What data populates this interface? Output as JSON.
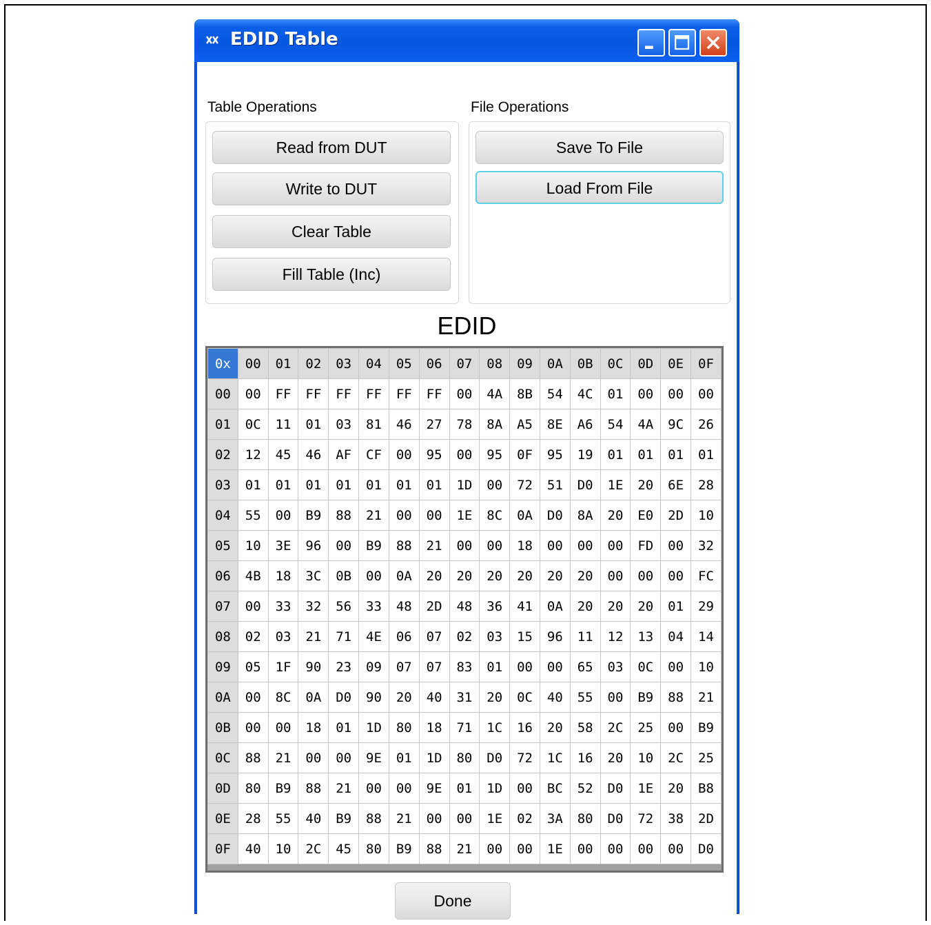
{
  "window": {
    "title": "EDID Table",
    "icon": "maxim-logo-icon",
    "controls": [
      "minimize-icon",
      "maximize-icon",
      "close-icon"
    ]
  },
  "table_operations": {
    "label": "Table Operations",
    "buttons": [
      "Read from DUT",
      "Write to DUT",
      "Clear Table",
      "Fill Table (Inc)"
    ]
  },
  "file_operations": {
    "label": "File Operations",
    "buttons": [
      "Save To File",
      "Load From File"
    ]
  },
  "edid": {
    "title": "EDID",
    "corner": "0x",
    "col_headers": [
      "00",
      "01",
      "02",
      "03",
      "04",
      "05",
      "06",
      "07",
      "08",
      "09",
      "0A",
      "0B",
      "0C",
      "0D",
      "0E",
      "0F"
    ],
    "row_headers": [
      "00",
      "01",
      "02",
      "03",
      "04",
      "05",
      "06",
      "07",
      "08",
      "09",
      "0A",
      "0B",
      "0C",
      "0D",
      "0E",
      "0F"
    ],
    "rows": [
      [
        "00",
        "FF",
        "FF",
        "FF",
        "FF",
        "FF",
        "FF",
        "00",
        "4A",
        "8B",
        "54",
        "4C",
        "01",
        "00",
        "00",
        "00"
      ],
      [
        "0C",
        "11",
        "01",
        "03",
        "81",
        "46",
        "27",
        "78",
        "8A",
        "A5",
        "8E",
        "A6",
        "54",
        "4A",
        "9C",
        "26"
      ],
      [
        "12",
        "45",
        "46",
        "AF",
        "CF",
        "00",
        "95",
        "00",
        "95",
        "0F",
        "95",
        "19",
        "01",
        "01",
        "01",
        "01"
      ],
      [
        "01",
        "01",
        "01",
        "01",
        "01",
        "01",
        "01",
        "1D",
        "00",
        "72",
        "51",
        "D0",
        "1E",
        "20",
        "6E",
        "28"
      ],
      [
        "55",
        "00",
        "B9",
        "88",
        "21",
        "00",
        "00",
        "1E",
        "8C",
        "0A",
        "D0",
        "8A",
        "20",
        "E0",
        "2D",
        "10"
      ],
      [
        "10",
        "3E",
        "96",
        "00",
        "B9",
        "88",
        "21",
        "00",
        "00",
        "18",
        "00",
        "00",
        "00",
        "FD",
        "00",
        "32"
      ],
      [
        "4B",
        "18",
        "3C",
        "0B",
        "00",
        "0A",
        "20",
        "20",
        "20",
        "20",
        "20",
        "20",
        "00",
        "00",
        "00",
        "FC"
      ],
      [
        "00",
        "33",
        "32",
        "56",
        "33",
        "48",
        "2D",
        "48",
        "36",
        "41",
        "0A",
        "20",
        "20",
        "20",
        "01",
        "29"
      ],
      [
        "02",
        "03",
        "21",
        "71",
        "4E",
        "06",
        "07",
        "02",
        "03",
        "15",
        "96",
        "11",
        "12",
        "13",
        "04",
        "14"
      ],
      [
        "05",
        "1F",
        "90",
        "23",
        "09",
        "07",
        "07",
        "83",
        "01",
        "00",
        "00",
        "65",
        "03",
        "0C",
        "00",
        "10"
      ],
      [
        "00",
        "8C",
        "0A",
        "D0",
        "90",
        "20",
        "40",
        "31",
        "20",
        "0C",
        "40",
        "55",
        "00",
        "B9",
        "88",
        "21"
      ],
      [
        "00",
        "00",
        "18",
        "01",
        "1D",
        "80",
        "18",
        "71",
        "1C",
        "16",
        "20",
        "58",
        "2C",
        "25",
        "00",
        "B9"
      ],
      [
        "88",
        "21",
        "00",
        "00",
        "9E",
        "01",
        "1D",
        "80",
        "D0",
        "72",
        "1C",
        "16",
        "20",
        "10",
        "2C",
        "25"
      ],
      [
        "80",
        "B9",
        "88",
        "21",
        "00",
        "00",
        "9E",
        "01",
        "1D",
        "00",
        "BC",
        "52",
        "D0",
        "1E",
        "20",
        "B8"
      ],
      [
        "28",
        "55",
        "40",
        "B9",
        "88",
        "21",
        "00",
        "00",
        "1E",
        "02",
        "3A",
        "80",
        "D0",
        "72",
        "38",
        "2D"
      ],
      [
        "40",
        "10",
        "2C",
        "45",
        "80",
        "B9",
        "88",
        "21",
        "00",
        "00",
        "1E",
        "00",
        "00",
        "00",
        "00",
        "D0"
      ]
    ]
  },
  "footer": {
    "done_label": "Done"
  },
  "colors": {
    "titlebar": "#0a5fe8",
    "corner_cell": "#3478d4",
    "header_cell": "#dcdcdc",
    "focus_ring": "#5fd0e2"
  }
}
